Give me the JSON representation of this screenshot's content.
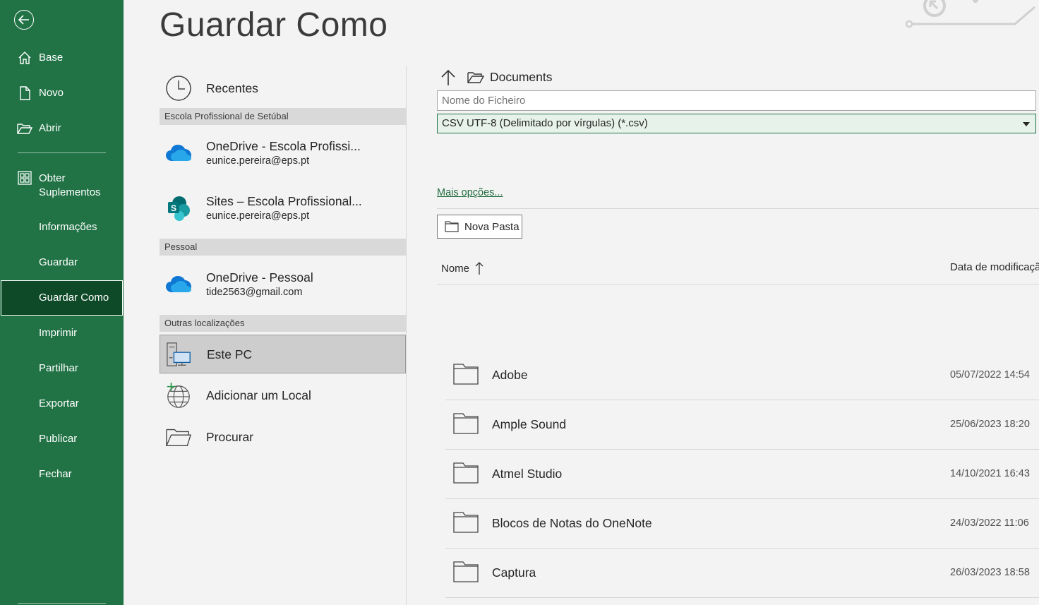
{
  "sidebar": {
    "back_icon": "arrow-left-circle-icon",
    "items": [
      {
        "label": "Base",
        "icon": "home-icon"
      },
      {
        "label": "Novo",
        "icon": "new-document-icon"
      },
      {
        "label": "Abrir",
        "icon": "open-folder-icon"
      },
      {
        "label": "Obter Suplementos",
        "icon": "apps-grid-icon"
      },
      {
        "label": "Informações"
      },
      {
        "label": "Guardar"
      },
      {
        "label": "Guardar Como",
        "selected": true
      },
      {
        "label": "Imprimir"
      },
      {
        "label": "Partilhar"
      },
      {
        "label": "Exportar"
      },
      {
        "label": "Publicar"
      },
      {
        "label": "Fechar"
      }
    ],
    "accent_color": "#217346",
    "selected_color": "#0e4a28"
  },
  "page": {
    "title": "Guardar Como"
  },
  "locations": {
    "recent": {
      "label": "Recentes",
      "icon": "clock-icon"
    },
    "group_school": "Escola Profissional de Setúbal",
    "onedrive_school": {
      "label": "OneDrive - Escola Profissi...",
      "account": "eunice.pereira@eps.pt",
      "icon": "onedrive-cloud-icon"
    },
    "sites_school": {
      "label": "Sites – Escola Profissional...",
      "account": "eunice.pereira@eps.pt",
      "icon": "sharepoint-icon"
    },
    "group_personal": "Pessoal",
    "onedrive_personal": {
      "label": "OneDrive - Pessoal",
      "account": "tide2563@gmail.com",
      "icon": "onedrive-cloud-icon"
    },
    "group_other": "Outras localizações",
    "this_pc": {
      "label": "Este PC",
      "icon": "computer-icon",
      "selected": true
    },
    "add_place": {
      "label": "Adicionar um Local",
      "icon": "globe-plus-icon"
    },
    "browse": {
      "label": "Procurar",
      "icon": "open-folder-icon"
    }
  },
  "save_panel": {
    "path": "Documents",
    "filename_placeholder": "Nome do Ficheiro",
    "filetype": "CSV UTF-8 (Delimitado por vírgulas) (*.csv)",
    "more_options": "Mais opções...",
    "new_folder": "Nova Pasta",
    "columns": {
      "name": "Nome",
      "date": "Data de modificação"
    },
    "files": [
      {
        "name": "Adobe",
        "date": "05/07/2022 14:54"
      },
      {
        "name": "Ample Sound",
        "date": "25/06/2023 18:20"
      },
      {
        "name": "Atmel Studio",
        "date": "14/10/2021 16:43"
      },
      {
        "name": "Blocos de Notas do OneNote",
        "date": "24/03/2022 11:06"
      },
      {
        "name": "Captura",
        "date": "26/03/2023 18:58"
      }
    ]
  }
}
